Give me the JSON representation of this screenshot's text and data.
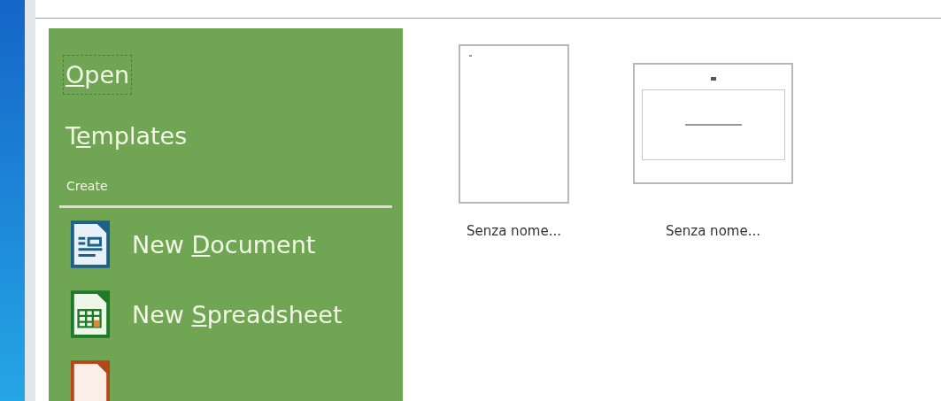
{
  "sidebar": {
    "items": [
      {
        "label_parts": {
          "mnemonic": "O",
          "after": "pen"
        },
        "focused": true
      },
      {
        "label_parts": {
          "before": "T",
          "mnemonic": "e",
          "after": "mplates"
        },
        "focused": false
      }
    ],
    "section_title": "Create",
    "create_items": [
      {
        "kind": "document",
        "label_parts": {
          "before": "New ",
          "mnemonic": "D",
          "after": "ocument"
        }
      },
      {
        "kind": "spreadsheet",
        "label_parts": {
          "before": "New ",
          "mnemonic": "S",
          "after": "preadsheet"
        }
      },
      {
        "kind": "presentation"
      }
    ]
  },
  "recent_files": [
    {
      "kind": "document",
      "name": "Senza nome..."
    },
    {
      "kind": "presentation",
      "name": "Senza nome..."
    }
  ]
}
